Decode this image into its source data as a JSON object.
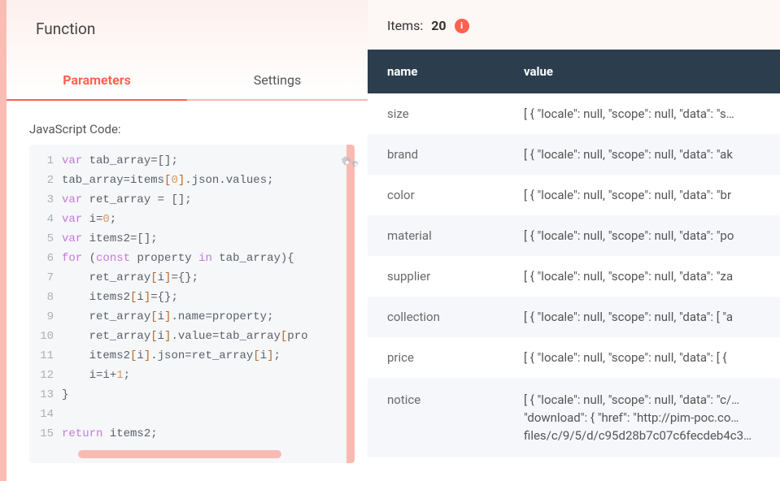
{
  "page_title": "Function",
  "tabs": {
    "parameters": "Parameters",
    "settings": "Settings"
  },
  "code_label": "JavaScript Code:",
  "code_lines": [
    [
      {
        "t": "var ",
        "c": "k"
      },
      {
        "t": "tab_array",
        "c": "v"
      },
      {
        "t": "=[];",
        "c": "p"
      }
    ],
    [
      {
        "t": "tab_array",
        "c": "v"
      },
      {
        "t": "=",
        "c": "p"
      },
      {
        "t": "items",
        "c": "v"
      },
      {
        "t": "[",
        "c": "br"
      },
      {
        "t": "0",
        "c": "n"
      },
      {
        "t": "]",
        "c": "br"
      },
      {
        "t": ".",
        "c": "p"
      },
      {
        "t": "json",
        "c": "v"
      },
      {
        "t": ".",
        "c": "p"
      },
      {
        "t": "values",
        "c": "v"
      },
      {
        "t": ";",
        "c": "p"
      }
    ],
    [
      {
        "t": "var ",
        "c": "k"
      },
      {
        "t": "ret_array",
        "c": "v"
      },
      {
        "t": " = [];",
        "c": "p"
      }
    ],
    [
      {
        "t": "var ",
        "c": "k"
      },
      {
        "t": "i",
        "c": "v"
      },
      {
        "t": "=",
        "c": "p"
      },
      {
        "t": "0",
        "c": "n"
      },
      {
        "t": ";",
        "c": "p"
      }
    ],
    [
      {
        "t": "var ",
        "c": "k"
      },
      {
        "t": "items2",
        "c": "v"
      },
      {
        "t": "=[];",
        "c": "p"
      }
    ],
    [
      {
        "t": "for ",
        "c": "k"
      },
      {
        "t": "(",
        "c": "p"
      },
      {
        "t": "const ",
        "c": "k"
      },
      {
        "t": "property",
        "c": "v"
      },
      {
        "t": " ",
        "c": "p"
      },
      {
        "t": "in ",
        "c": "k"
      },
      {
        "t": "tab_array",
        "c": "v"
      },
      {
        "t": "){",
        "c": "p"
      }
    ],
    [
      {
        "t": "    ret_array",
        "c": "v"
      },
      {
        "t": "[",
        "c": "br"
      },
      {
        "t": "i",
        "c": "v"
      },
      {
        "t": "]",
        "c": "br"
      },
      {
        "t": "={};",
        "c": "p"
      }
    ],
    [
      {
        "t": "    items2",
        "c": "v"
      },
      {
        "t": "[",
        "c": "br"
      },
      {
        "t": "i",
        "c": "v"
      },
      {
        "t": "]",
        "c": "br"
      },
      {
        "t": "={};",
        "c": "p"
      }
    ],
    [
      {
        "t": "    ret_array",
        "c": "v"
      },
      {
        "t": "[",
        "c": "br"
      },
      {
        "t": "i",
        "c": "v"
      },
      {
        "t": "]",
        "c": "br"
      },
      {
        "t": ".",
        "c": "p"
      },
      {
        "t": "name",
        "c": "v"
      },
      {
        "t": "=",
        "c": "p"
      },
      {
        "t": "property",
        "c": "v"
      },
      {
        "t": ";",
        "c": "p"
      }
    ],
    [
      {
        "t": "    ret_array",
        "c": "v"
      },
      {
        "t": "[",
        "c": "br"
      },
      {
        "t": "i",
        "c": "v"
      },
      {
        "t": "]",
        "c": "br"
      },
      {
        "t": ".",
        "c": "p"
      },
      {
        "t": "value",
        "c": "v"
      },
      {
        "t": "=",
        "c": "p"
      },
      {
        "t": "tab_array",
        "c": "v"
      },
      {
        "t": "[",
        "c": "br"
      },
      {
        "t": "pro",
        "c": "v"
      }
    ],
    [
      {
        "t": "    items2",
        "c": "v"
      },
      {
        "t": "[",
        "c": "br"
      },
      {
        "t": "i",
        "c": "v"
      },
      {
        "t": "]",
        "c": "br"
      },
      {
        "t": ".",
        "c": "p"
      },
      {
        "t": "json",
        "c": "v"
      },
      {
        "t": "=",
        "c": "p"
      },
      {
        "t": "ret_array",
        "c": "v"
      },
      {
        "t": "[",
        "c": "br"
      },
      {
        "t": "i",
        "c": "v"
      },
      {
        "t": "]",
        "c": "br"
      },
      {
        "t": ";",
        "c": "p"
      }
    ],
    [
      {
        "t": "    i",
        "c": "v"
      },
      {
        "t": "=",
        "c": "p"
      },
      {
        "t": "i",
        "c": "v"
      },
      {
        "t": "+",
        "c": "p"
      },
      {
        "t": "1",
        "c": "n"
      },
      {
        "t": ";",
        "c": "p"
      }
    ],
    [
      {
        "t": "}",
        "c": "p"
      }
    ],
    [
      {
        "t": "",
        "c": "p"
      }
    ],
    [
      {
        "t": "return ",
        "c": "k"
      },
      {
        "t": "items2",
        "c": "v"
      },
      {
        "t": ";",
        "c": "p"
      }
    ]
  ],
  "items_label": "Items:",
  "items_count": "20",
  "table": {
    "headers": {
      "name": "name",
      "value": "value"
    },
    "rows": [
      {
        "name": "size",
        "value": "[ { \"locale\": null, \"scope\": null, \"data\": \"s…"
      },
      {
        "name": "brand",
        "value": "[ { \"locale\": null, \"scope\": null, \"data\": \"ak"
      },
      {
        "name": "color",
        "value": "[ { \"locale\": null, \"scope\": null, \"data\": \"br"
      },
      {
        "name": "material",
        "value": "[ { \"locale\": null, \"scope\": null, \"data\": \"po"
      },
      {
        "name": "supplier",
        "value": "[ { \"locale\": null, \"scope\": null, \"data\": \"za"
      },
      {
        "name": "collection",
        "value": "[ { \"locale\": null, \"scope\": null, \"data\": [ \"a"
      },
      {
        "name": "price",
        "value": "[ { \"locale\": null, \"scope\": null, \"data\": [ { "
      },
      {
        "name": "notice",
        "value": "[ { \"locale\": null, \"scope\": null, \"data\": \"c/… \"download\": { \"href\": \"http://pim-poc.co… files/c/9/5/d/c95d28b7c07c6fecdeb4c3…"
      }
    ]
  }
}
